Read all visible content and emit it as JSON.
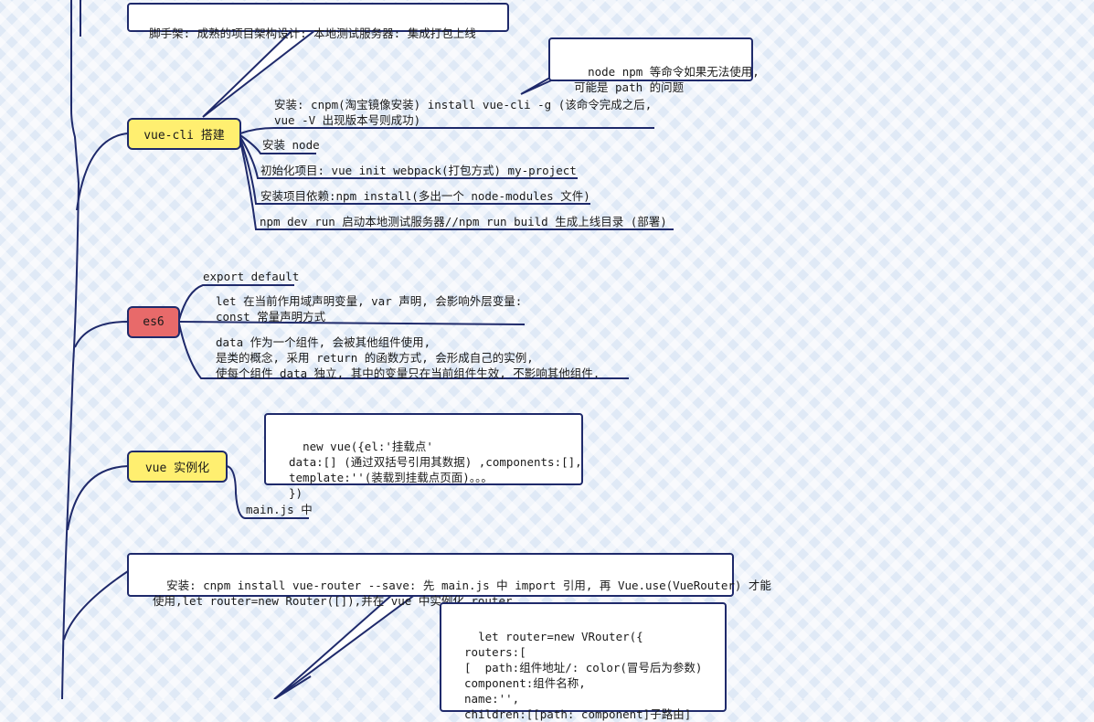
{
  "nodes": {
    "vue_cli": "vue-cli 搭建",
    "es6": "es6",
    "vue_instance": "vue 实例化"
  },
  "callouts": {
    "scaffold": "脚手架: 成熟的项目架构设计: 本地测试服务器: 集成打包上线",
    "npm_note": "node npm 等命令如果无法使用,\n可能是 path 的问题",
    "new_vue": "new vue({el:'挂载点'\ndata:[] (通过双括号引用其数据) ,components:[],\ntemplate:''(装载到挂载点页面)。。。\n})",
    "router_install": "安装: cnpm install vue-router --save: 先 main.js 中 import 引用, 再 Vue.use(VueRouter) 才能\n使用,let router=new Router([]),并在 vue 中实例化 router",
    "router_code": "let router=new VRouter({\nrouters:[\n[  path:组件地址/: color(冒号后为参数)\ncomponent:组件名称,\nname:'',\nchildren:[[path: component]子路由]"
  },
  "vue_cli_branches": {
    "install_cli": "安装: cnpm(淘宝镜像安装) install vue-cli -g (该命令完成之后,\nvue -V 出现版本号则成功)",
    "install_node": "安装 node",
    "init_project": "初始化项目: vue init webpack(打包方式) my-project",
    "install_deps": "安装项目依赖:npm install(多出一个 node-modules 文件)",
    "run_dev": "npm dev run 启动本地测试服务器//npm run build 生成上线目录 (部署)"
  },
  "es6_branches": {
    "export_default": "export default",
    "let_const": "let 在当前作用域声明变量, var 声明, 会影响外层变量:\nconst 常量声明方式",
    "data_fn": "data 作为一个组件, 会被其他组件使用,\n是类的概念, 采用 return 的函数方式, 会形成自己的实例,\n使每个组件 data 独立, 其中的变量只在当前组件生效, 不影响其他组件."
  },
  "vue_instance_branches": {
    "main_js": "main.js 中"
  },
  "colors": {
    "line": "#1f2a6b",
    "node_yellow": "#ffef70",
    "node_red": "#e86a6a"
  }
}
